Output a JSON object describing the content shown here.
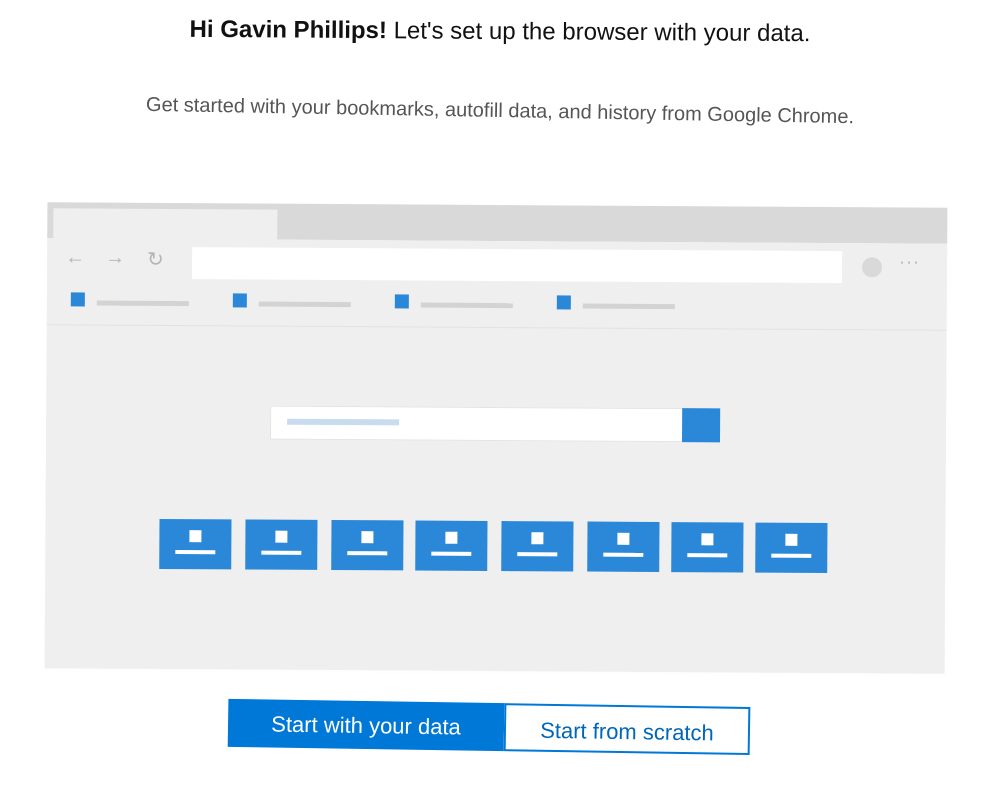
{
  "greeting": {
    "name": "Hi Gavin Phillips!",
    "message": " Let's set up the browser with your data."
  },
  "subtitle": "Get started with your bookmarks, autofill data, and history from Google Chrome.",
  "illustration": {
    "nav_icons": {
      "back": "←",
      "forward": "→",
      "refresh": "↻",
      "more": "···"
    },
    "favorites_count": 4,
    "tile_count": 8,
    "colors": {
      "accent": "#2b88d8",
      "frame": "#d9d9d9",
      "body": "#efefef"
    }
  },
  "buttons": {
    "primary_label": "Start with your data",
    "secondary_label": "Start from scratch"
  },
  "colors": {
    "primary_button": "#0078d7",
    "secondary_text": "#0067b8"
  }
}
